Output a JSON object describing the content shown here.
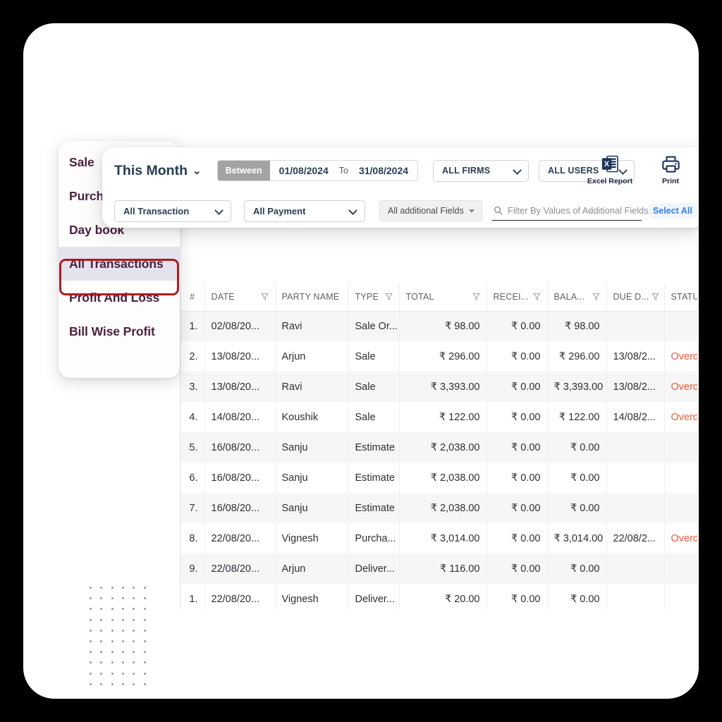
{
  "app": {
    "frame_bg": "#000000",
    "card_bg": "#ffffff"
  },
  "sidebar": {
    "items": [
      {
        "label": "Sale",
        "clipped": true,
        "active": false
      },
      {
        "label": "Purchase",
        "clipped": true,
        "active": false
      },
      {
        "label": "Day book",
        "clipped": false,
        "active": false
      },
      {
        "label": "All Transactions",
        "clipped": false,
        "active": true
      },
      {
        "label": "Profit And Loss",
        "clipped": false,
        "active": false
      },
      {
        "label": "Bill Wise Profit",
        "clipped": false,
        "active": false
      }
    ],
    "active_highlight_color": "#a91d21",
    "active_bg": "#e4e2ec",
    "text_color": "#4c2140"
  },
  "toolbar": {
    "period_label": "This Month",
    "period_caret": "chevron-down-icon",
    "between_label": "Between",
    "date_from": "01/08/2024",
    "date_to_label": "To",
    "date_to": "31/08/2024",
    "firms_select": "ALL FIRMS",
    "users_select": "ALL USERS",
    "transaction_select": "All Transaction",
    "payment_select": "All Payment",
    "additional_fields_select": "All additional Fields",
    "search_placeholder": "Filter By Values of Additional Fields",
    "search_value": "",
    "select_all_label": "Select All",
    "select_all_color": "#2d7ff0",
    "actions": [
      {
        "label": "Excel Report",
        "icon": "excel-file-icon"
      },
      {
        "label": "Print",
        "icon": "printer-icon"
      }
    ]
  },
  "table": {
    "columns": [
      {
        "key": "idx",
        "label": "#",
        "filter": false
      },
      {
        "key": "date",
        "label": "DATE",
        "filter": true
      },
      {
        "key": "party",
        "label": "PARTY NAME",
        "filter": false
      },
      {
        "key": "type",
        "label": "TYPE",
        "filter": true
      },
      {
        "key": "total",
        "label": "TOTAL",
        "filter": true
      },
      {
        "key": "recv",
        "label": "RECEI...",
        "filter": true
      },
      {
        "key": "bal",
        "label": "BALA...",
        "filter": true
      },
      {
        "key": "due",
        "label": "DUE D...",
        "filter": true
      },
      {
        "key": "status",
        "label": "STATUS",
        "filter": true
      }
    ],
    "overdue_color": "#f05a34",
    "rows": [
      {
        "idx": "1.",
        "date": "02/08/20...",
        "party": "Ravi",
        "type": "Sale Or...",
        "total": "₹ 98.00",
        "recv": "₹ 0.00",
        "bal": "₹ 98.00",
        "due": "",
        "status": ""
      },
      {
        "idx": "2.",
        "date": "13/08/20...",
        "party": "Arjun",
        "type": "Sale",
        "total": "₹ 296.00",
        "recv": "₹ 0.00",
        "bal": "₹ 296.00",
        "due": "13/08/2...",
        "status": "Overdue"
      },
      {
        "idx": "3.",
        "date": "13/08/20...",
        "party": "Ravi",
        "type": "Sale",
        "total": "₹ 3,393.00",
        "recv": "₹ 0.00",
        "bal": "₹ 3,393.00",
        "due": "13/08/2...",
        "status": "Overdue"
      },
      {
        "idx": "4.",
        "date": "14/08/20...",
        "party": "Koushik",
        "type": "Sale",
        "total": "₹ 122.00",
        "recv": "₹ 0.00",
        "bal": "₹ 122.00",
        "due": "14/08/2...",
        "status": "Overdue"
      },
      {
        "idx": "5.",
        "date": "16/08/20...",
        "party": "Sanju",
        "type": "Estimate",
        "total": "₹ 2,038.00",
        "recv": "₹ 0.00",
        "bal": "₹ 0.00",
        "due": "",
        "status": ""
      },
      {
        "idx": "6.",
        "date": "16/08/20...",
        "party": "Sanju",
        "type": "Estimate",
        "total": "₹ 2,038.00",
        "recv": "₹ 0.00",
        "bal": "₹ 0.00",
        "due": "",
        "status": ""
      },
      {
        "idx": "7.",
        "date": "16/08/20...",
        "party": "Sanju",
        "type": "Estimate",
        "total": "₹ 2,038.00",
        "recv": "₹ 0.00",
        "bal": "₹ 0.00",
        "due": "",
        "status": ""
      },
      {
        "idx": "8.",
        "date": "22/08/20...",
        "party": "Vignesh",
        "type": "Purcha...",
        "total": "₹ 3,014.00",
        "recv": "₹ 0.00",
        "bal": "₹ 3,014.00",
        "due": "22/08/2...",
        "status": "Overdue"
      },
      {
        "idx": "9.",
        "date": "22/08/20...",
        "party": "Arjun",
        "type": "Deliver...",
        "total": "₹ 116.00",
        "recv": "₹ 0.00",
        "bal": "₹ 0.00",
        "due": "",
        "status": ""
      },
      {
        "idx": "1.",
        "date": "22/08/20...",
        "party": "Vignesh",
        "type": "Deliver...",
        "total": "₹ 20.00",
        "recv": "₹ 0.00",
        "bal": "₹ 0.00",
        "due": "",
        "status": ""
      }
    ]
  },
  "decoration": {
    "dot_grid_cols": 6,
    "dot_grid_rows": 10,
    "dot_color": "#9e9aa3"
  }
}
